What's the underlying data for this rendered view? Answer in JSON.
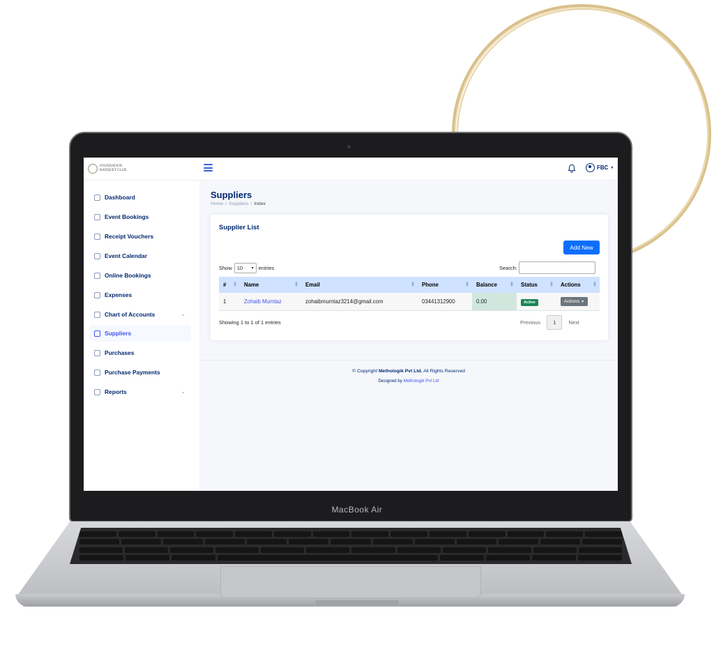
{
  "app": {
    "logo_text_line1": "FOUNDATION",
    "logo_text_line2": "BANQUET CLUB",
    "user_label": "FBC"
  },
  "device_label": "MacBook Air",
  "sidebar": {
    "items": [
      {
        "label": "Dashboard",
        "icon": "grid-icon"
      },
      {
        "label": "Event Bookings",
        "icon": "calendar-icon"
      },
      {
        "label": "Receipt Vouchers",
        "icon": "receipt-icon"
      },
      {
        "label": "Event Calendar",
        "icon": "calendar-icon"
      },
      {
        "label": "Online Bookings",
        "icon": "bookmark-icon"
      },
      {
        "label": "Expenses",
        "icon": "cash-icon"
      },
      {
        "label": "Chart of Accounts",
        "icon": "ledger-icon"
      },
      {
        "label": "Suppliers",
        "icon": "truck-icon"
      },
      {
        "label": "Purchases",
        "icon": "cart-icon"
      },
      {
        "label": "Purchase Payments",
        "icon": "payment-icon"
      },
      {
        "label": "Reports",
        "icon": "report-icon"
      }
    ]
  },
  "page": {
    "title": "Suppliers",
    "breadcrumb": [
      "Home",
      "/",
      "Suppliers",
      "/",
      "Index"
    ]
  },
  "card": {
    "title": "Supplier List",
    "add_button": "Add New",
    "show_label": "Show",
    "entries_value": "10",
    "entries_label": "entries",
    "search_label": "Search:",
    "columns": [
      "#",
      "Name",
      "Email",
      "Phone",
      "Balance",
      "Status",
      "Actions"
    ],
    "rows": [
      {
        "num": "1",
        "name": "Zohaib Mumtaz",
        "email": "zohaibmumtaz3214@gmail.com",
        "phone": "03441312900",
        "balance": "0.00",
        "status": "Active",
        "actions": "Actions"
      }
    ],
    "info": "Showing 1 to 1 of 1 entries",
    "pager": {
      "previous": "Previous",
      "current": "1",
      "next": "Next"
    }
  },
  "footer": {
    "copyright_prefix": "© Copyright",
    "company": "Methologik Pvt Ltd.",
    "rights": "All Rights Reserved",
    "designed_by": "Designed by",
    "designer": "Methologik Pvt Ltd"
  },
  "colors": {
    "accent": "#4154f1",
    "primary_button": "#0d6efd",
    "header_blue": "#cfe2ff",
    "nav_text": "#012970",
    "success": "#198754"
  }
}
